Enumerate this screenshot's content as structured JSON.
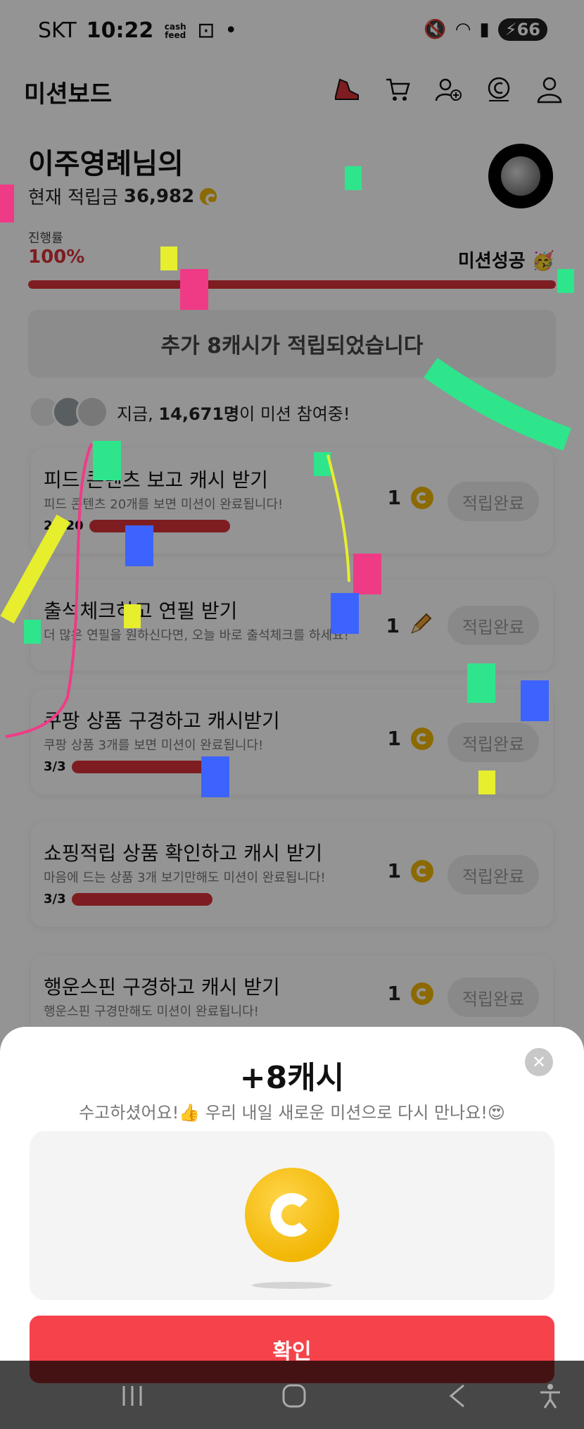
{
  "status_bar": {
    "carrier": "SKT",
    "time": "10:22",
    "app_badge": "cash feed",
    "battery": "66"
  },
  "header": {
    "title": "미션보드"
  },
  "profile": {
    "greeting": "이주영례님의",
    "balance_label": "현재 적립금",
    "balance_value": "36,982"
  },
  "progress": {
    "label": "진행률",
    "percent_text": "100%",
    "percent": 100,
    "status": "미션성공 🥳"
  },
  "banner": {
    "text": "추가 8캐시가 적립되었습니다"
  },
  "participants": {
    "prefix": "지금, ",
    "count": "14,671명",
    "suffix": "이 미션 참여중!"
  },
  "missions": [
    {
      "title": "피드 콘텐츠 보고 캐시 받기",
      "desc": "피드 콘텐츠 20개를 보면 미션이 완료됩니다!",
      "progress": "20/20",
      "reward": "1",
      "reward_icon": "coin-icon",
      "button": "적립완료"
    },
    {
      "title": "출석체크하고 연필 받기",
      "desc": "더 많은 연필을 원하신다면, 오늘 바로 출석체크를 하세요!",
      "progress": "",
      "reward": "1",
      "reward_icon": "pencil-icon",
      "button": "적립완료"
    },
    {
      "title": "쿠팡 상품 구경하고 캐시받기",
      "desc": "쿠팡 상품 3개를 보면 미션이 완료됩니다!",
      "progress": "3/3",
      "reward": "1",
      "reward_icon": "coin-icon",
      "button": "적립완료"
    },
    {
      "title": "쇼핑적립 상품 확인하고 캐시 받기",
      "desc": "마음에 드는 상품 3개 보기만해도 미션이 완료됩니다!",
      "progress": "3/3",
      "reward": "1",
      "reward_icon": "coin-icon",
      "button": "적립완료"
    },
    {
      "title": "행운스핀 구경하고 캐시 받기",
      "desc": "행운스핀 구경만해도 미션이 완료됩니다!",
      "progress": "",
      "reward": "1",
      "reward_icon": "coin-icon",
      "button": "적립완료"
    }
  ],
  "sheet": {
    "title": "+8캐시",
    "subtitle": "수고하셨어요!👍 우리 내일 새로운 미션으로 다시 만나요!😍",
    "confirm": "확인"
  },
  "colors": {
    "accent": "#d9323a",
    "confirm": "#f6424a",
    "coin": "#f2b705"
  }
}
